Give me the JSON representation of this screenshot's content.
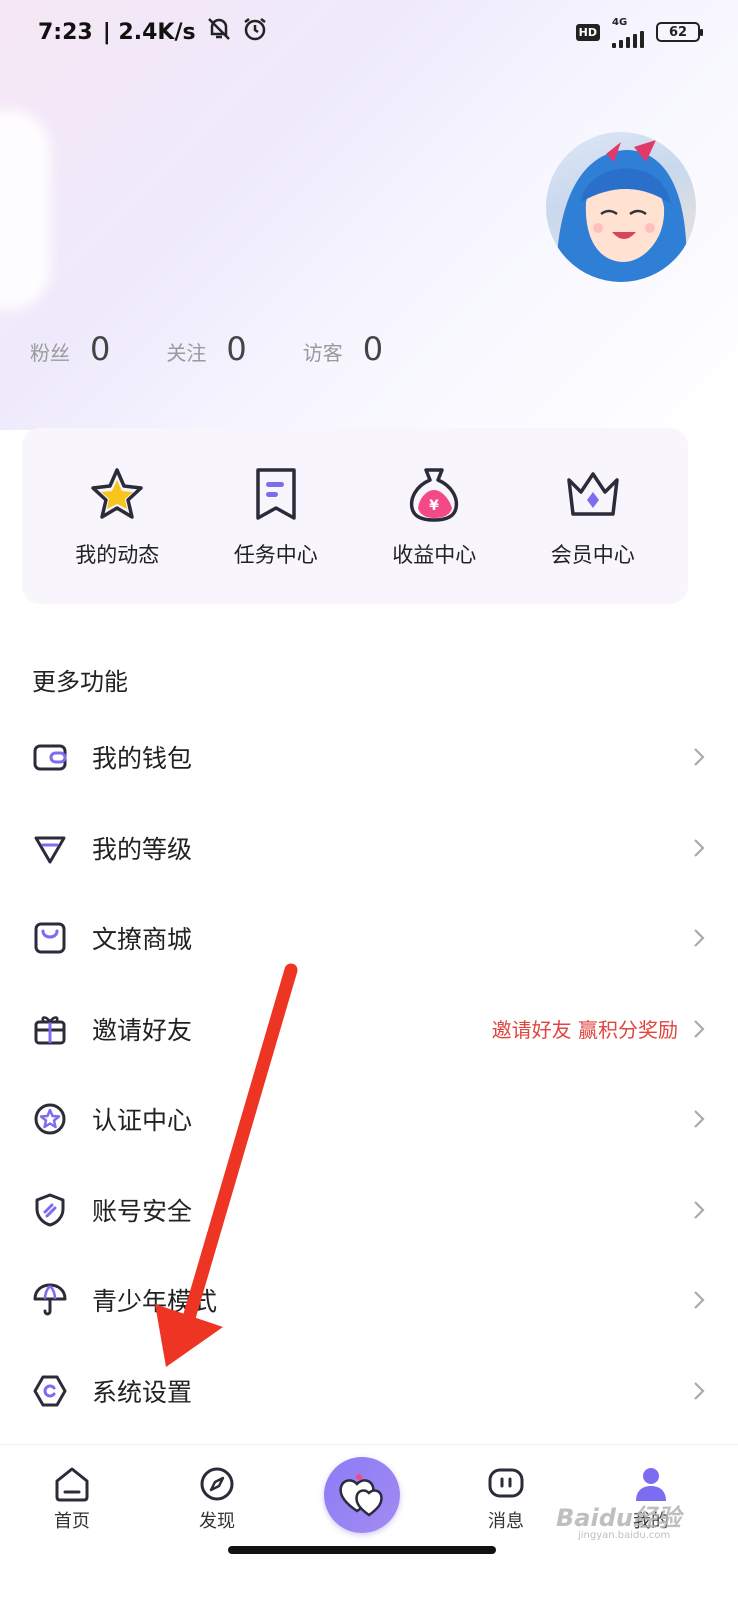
{
  "status_bar": {
    "time": "7:23",
    "speed": "| 2.4K/s",
    "hd": "HD",
    "network": "4G",
    "battery": "62"
  },
  "profile": {
    "stats": [
      {
        "label": "粉丝",
        "value": "0"
      },
      {
        "label": "关注",
        "value": "0"
      },
      {
        "label": "访客",
        "value": "0"
      }
    ]
  },
  "quick_actions": [
    {
      "label": "我的动态",
      "icon": "star-icon"
    },
    {
      "label": "任务中心",
      "icon": "bookmark-icon"
    },
    {
      "label": "收益中心",
      "icon": "money-bag-icon"
    },
    {
      "label": "会员中心",
      "icon": "crown-icon"
    }
  ],
  "more": {
    "title": "更多功能",
    "items": [
      {
        "label": "我的钱包",
        "icon": "wallet-icon",
        "hint": ""
      },
      {
        "label": "我的等级",
        "icon": "diamond-icon",
        "hint": ""
      },
      {
        "label": "文撩商城",
        "icon": "shopping-bag-icon",
        "hint": ""
      },
      {
        "label": "邀请好友",
        "icon": "gift-icon",
        "hint": "邀请好友 赢积分奖励"
      },
      {
        "label": "认证中心",
        "icon": "badge-icon",
        "hint": ""
      },
      {
        "label": "账号安全",
        "icon": "shield-icon",
        "hint": ""
      },
      {
        "label": "青少年模式",
        "icon": "umbrella-icon",
        "hint": ""
      },
      {
        "label": "系统设置",
        "icon": "settings-icon",
        "hint": ""
      }
    ]
  },
  "bottom_nav": {
    "items": [
      {
        "label": "首页",
        "icon": "home-icon"
      },
      {
        "label": "发现",
        "icon": "compass-icon"
      },
      {
        "label": "",
        "icon": "hearts-icon"
      },
      {
        "label": "消息",
        "icon": "message-icon"
      },
      {
        "label": "我的",
        "icon": "profile-icon"
      }
    ]
  },
  "watermark": {
    "brand": "Baidu经验",
    "url": "jingyan.baidu.com"
  },
  "colors": {
    "accent": "#7b6cf0",
    "hint": "#e0463f",
    "annotation_arrow": "#ee3524"
  }
}
